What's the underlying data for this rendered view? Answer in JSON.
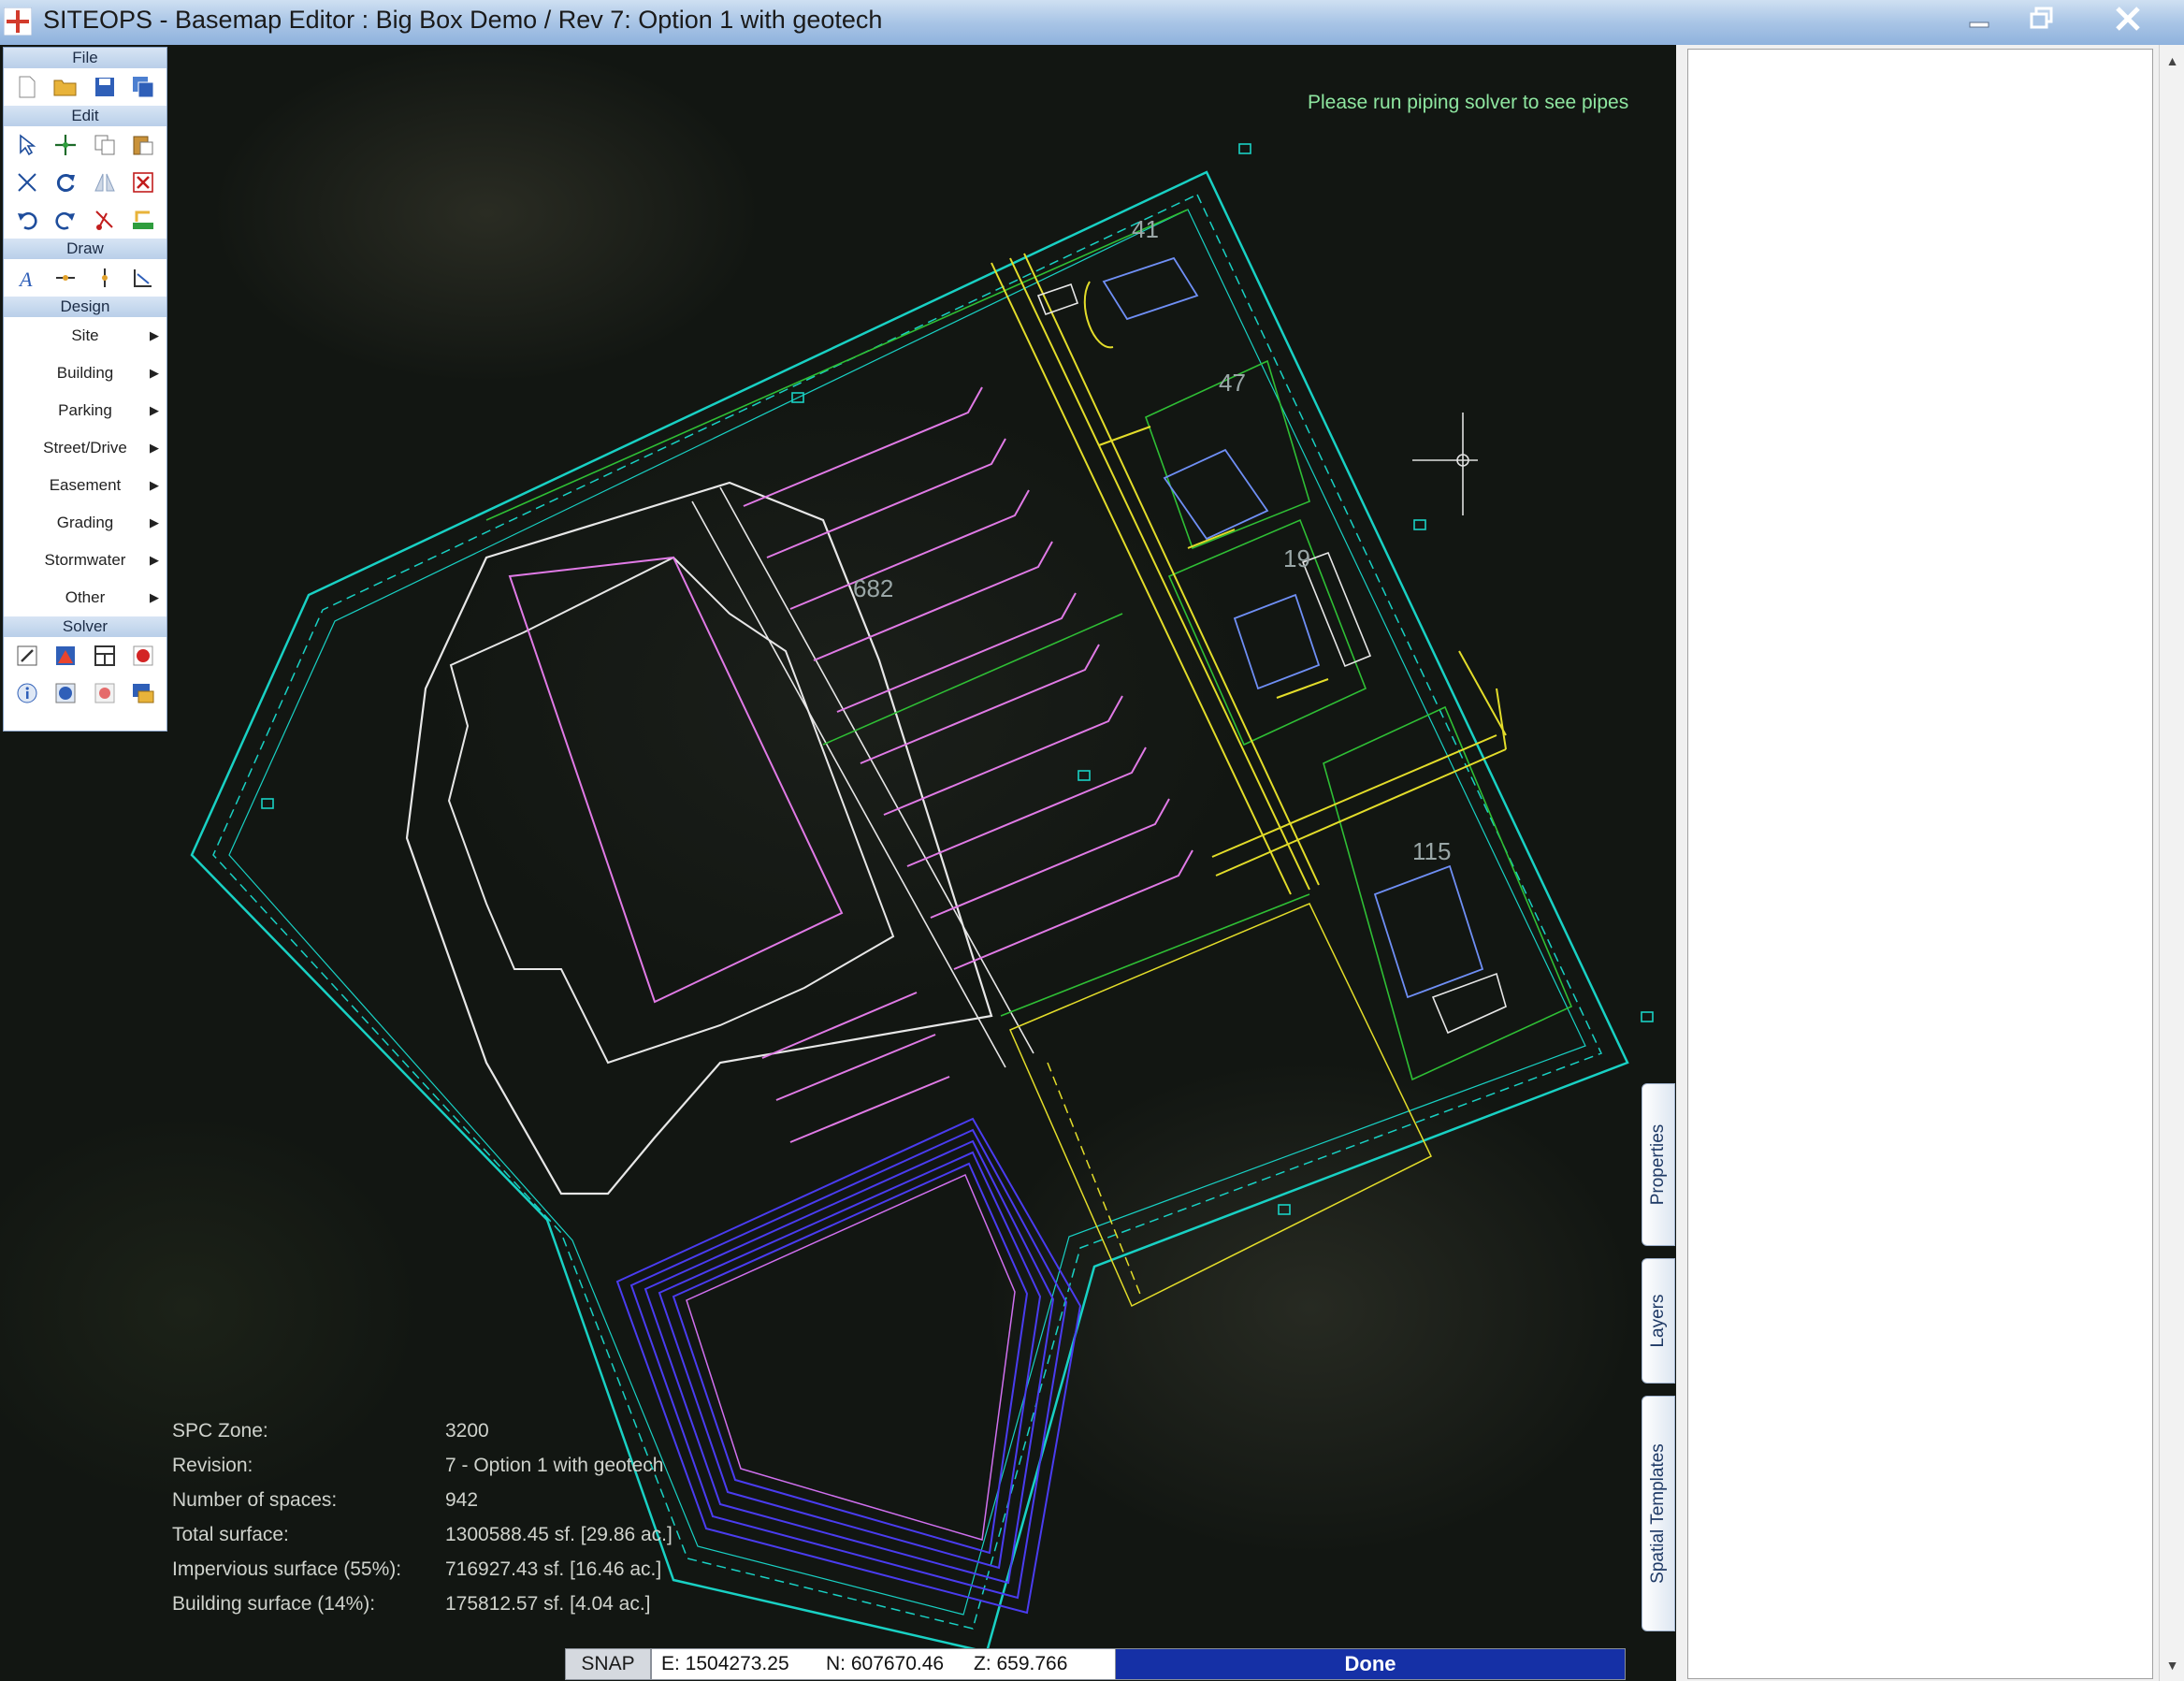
{
  "window": {
    "title": "SITEOPS - Basemap Editor : Big Box Demo / Rev 7: Option 1 with geotech",
    "controls": [
      "minimize-icon",
      "restore-icon",
      "close-icon"
    ]
  },
  "palette": {
    "sections": {
      "file": "File",
      "edit": "Edit",
      "draw": "Draw",
      "design": "Design",
      "solver": "Solver"
    },
    "file_icons": [
      "new-file-icon",
      "open-folder-icon",
      "save-icon",
      "save-as-icon"
    ],
    "edit_icons_row1": [
      "select-arrow-icon",
      "move-icon",
      "copy-icon",
      "paste-icon"
    ],
    "edit_icons_row2": [
      "scale-icon",
      "rotate-icon",
      "mirror-icon",
      "delete-icon"
    ],
    "edit_icons_row3": [
      "undo-icon",
      "redo-icon",
      "trim-icon",
      "offset-icon"
    ],
    "draw_icons": [
      "text-icon",
      "line-icon",
      "vertical-line-icon",
      "dimension-icon"
    ],
    "design_items": [
      "Site",
      "Building",
      "Parking",
      "Street/Drive",
      "Easement",
      "Grading",
      "Stormwater",
      "Other"
    ],
    "solver_icons_row1": [
      "edit-solver-icon",
      "chart-icon",
      "grid-icon",
      "record-icon"
    ],
    "solver_icons_row2": [
      "info-icon",
      "globe-icon",
      "stop-icon",
      "report-icon"
    ]
  },
  "map": {
    "solver_message": "Please run piping solver to see pipes",
    "parking_counts": [
      "41",
      "47",
      "19",
      "115",
      "682"
    ]
  },
  "site_stats": [
    {
      "label": "SPC Zone:",
      "value": "3200"
    },
    {
      "label": "Revision:",
      "value": "7 - Option 1 with geotech"
    },
    {
      "label": "Number of spaces:",
      "value": "942"
    },
    {
      "label": "Total surface:",
      "value": "1300588.45 sf. [29.86 ac.]"
    },
    {
      "label": "Impervious surface (55%):",
      "value": "716927.43 sf. [16.46 ac.]"
    },
    {
      "label": "Building surface (14%):",
      "value": "175812.57 sf. [4.04 ac.]"
    }
  ],
  "statusbar": {
    "snap_label": "SNAP",
    "easting": "E: 1504273.25",
    "northing": "N: 607670.46",
    "elevation": "Z: 659.766",
    "progress_label": "Done",
    "progress_fraction": 1.0
  },
  "side_tabs": [
    "Properties",
    "Layers",
    "Spatial Templates"
  ],
  "colors": {
    "boundary": "#19d1c4",
    "building": "#e7e7e7",
    "parking_stripe": "#c9c9c9",
    "islands": "#e07ae6",
    "drives": "#e3dd2a",
    "green": "#2fbf35",
    "pond": "#4a3cf0",
    "accent_progress": "#1530a6"
  }
}
